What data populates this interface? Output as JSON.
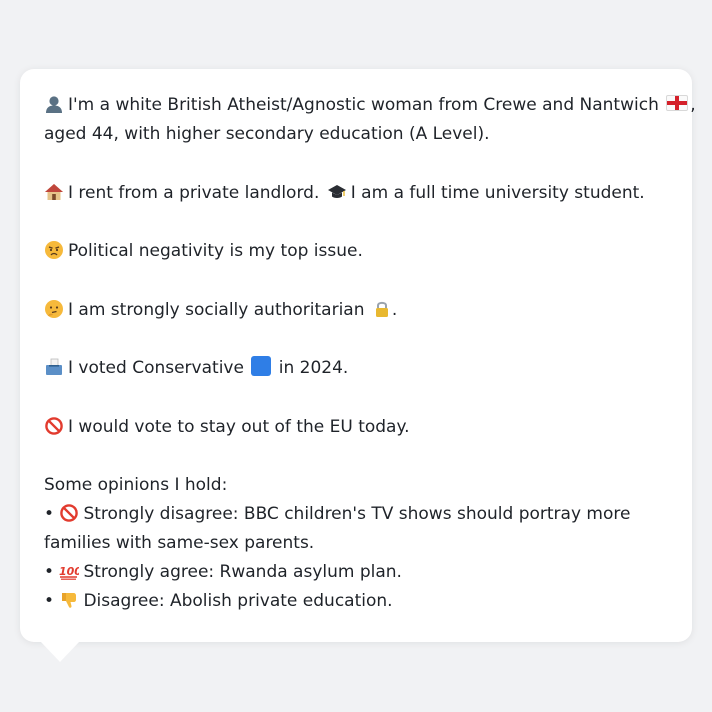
{
  "intro": {
    "icon": "bust-in-silhouette-icon",
    "line1_text": "I'm a white British Atheist/Agnostic woman from Crewe and Nantwich",
    "flag_icon": "england-flag-icon",
    "line1_suffix": ",",
    "line2_text": "aged 44, with higher secondary education (A Level)."
  },
  "housing": {
    "house_icon": "house-icon",
    "rent_text": "I rent from a private landlord.",
    "cap_icon": "graduation-cap-icon",
    "student_text": "I am a full time university student."
  },
  "issue": {
    "icon": "angry-face-icon",
    "text": "Political negativity is my top issue."
  },
  "social": {
    "icon": "thinking-face-icon",
    "text": "I am strongly socially authoritarian",
    "lock_icon": "lock-icon",
    "suffix": "."
  },
  "vote": {
    "icon": "ballot-box-icon",
    "text_before": "I voted Conservative",
    "party_color": "#2f7ee6",
    "text_after": "in 2024."
  },
  "eu": {
    "icon": "prohibited-icon",
    "text": "I would vote to stay out of the EU today."
  },
  "opinions": {
    "heading": "Some opinions I hold:",
    "bullet": "•",
    "items": [
      {
        "icon": "prohibited-icon",
        "line1": "Strongly disagree: BBC children's TV shows should portray more",
        "line2": "families with same-sex parents."
      },
      {
        "icon": "hundred-points-icon",
        "line1": "Strongly agree: Rwanda asylum plan."
      },
      {
        "icon": "thumbs-down-icon",
        "line1": "Disagree: Abolish private education."
      }
    ]
  }
}
